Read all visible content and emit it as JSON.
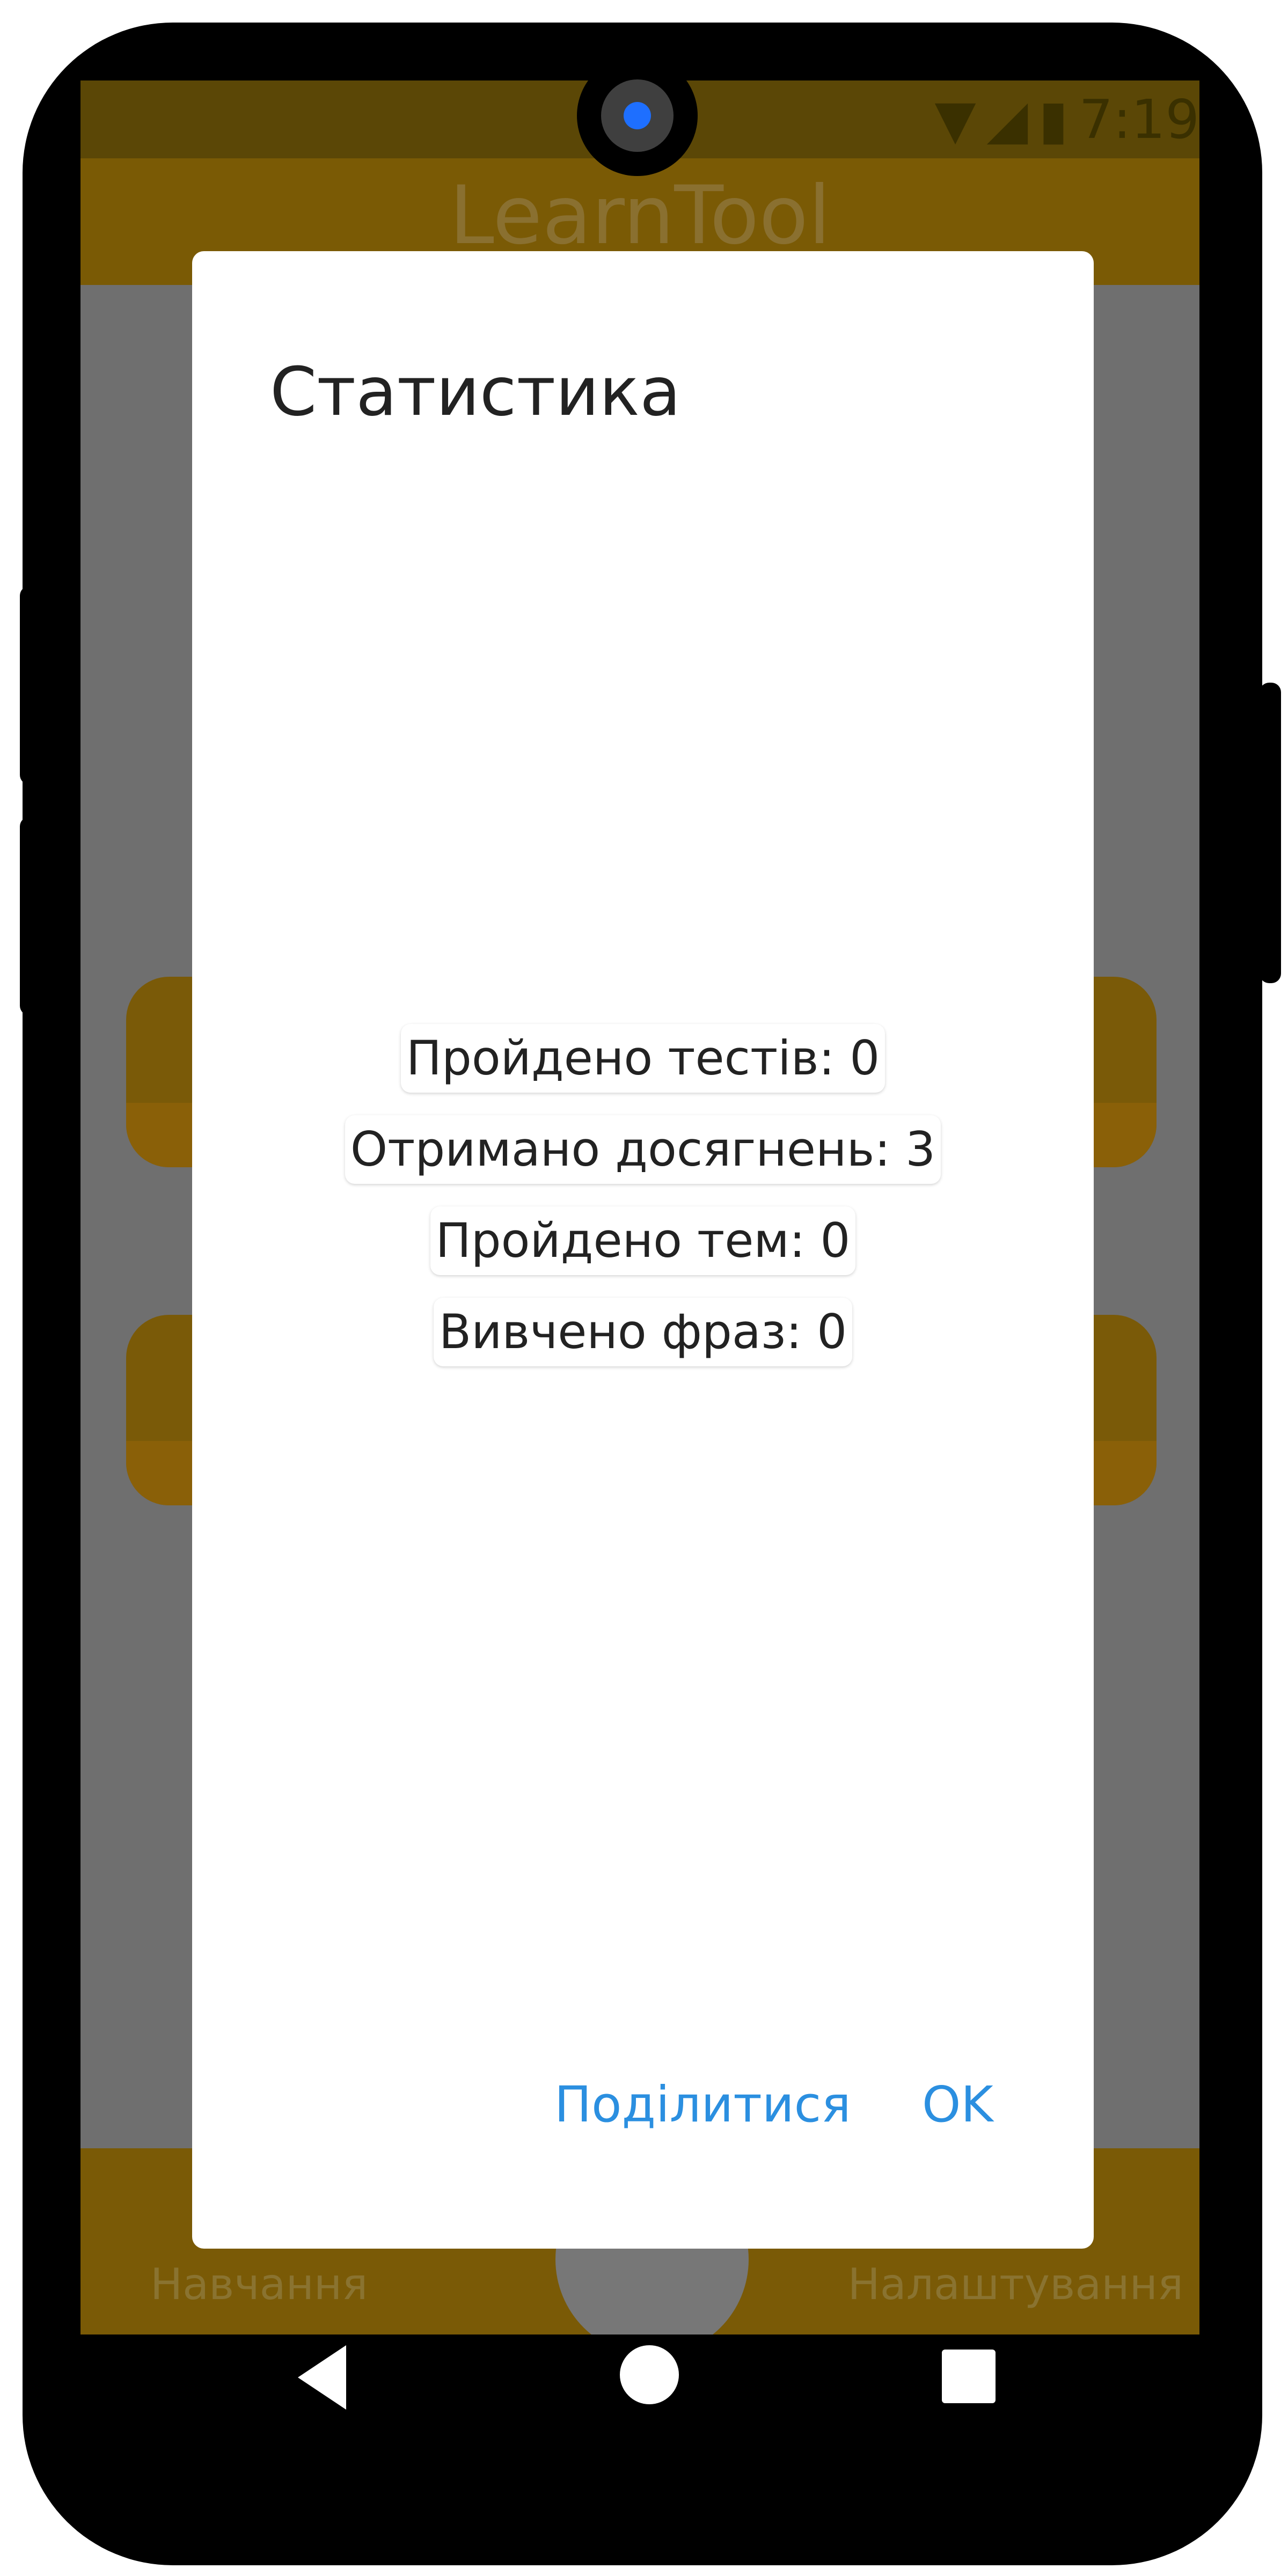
{
  "app": {
    "toolbar_title": "LearnTool"
  },
  "status_bar": {
    "time": "7:19"
  },
  "bottom_nav": {
    "left_label": "Навчання",
    "right_label": "Налаштування"
  },
  "dialog": {
    "title": "Статистика",
    "stats": [
      "Пройдено тестів: 0",
      "Отримано досягнень: 3",
      "Пройдено тем: 0",
      "Вивчено фраз: 0"
    ],
    "share_label": "Поділитися",
    "ok_label": "OK"
  },
  "colors": {
    "accent_blue": "#2b8fe0",
    "app_amber": "#7a5a05"
  }
}
